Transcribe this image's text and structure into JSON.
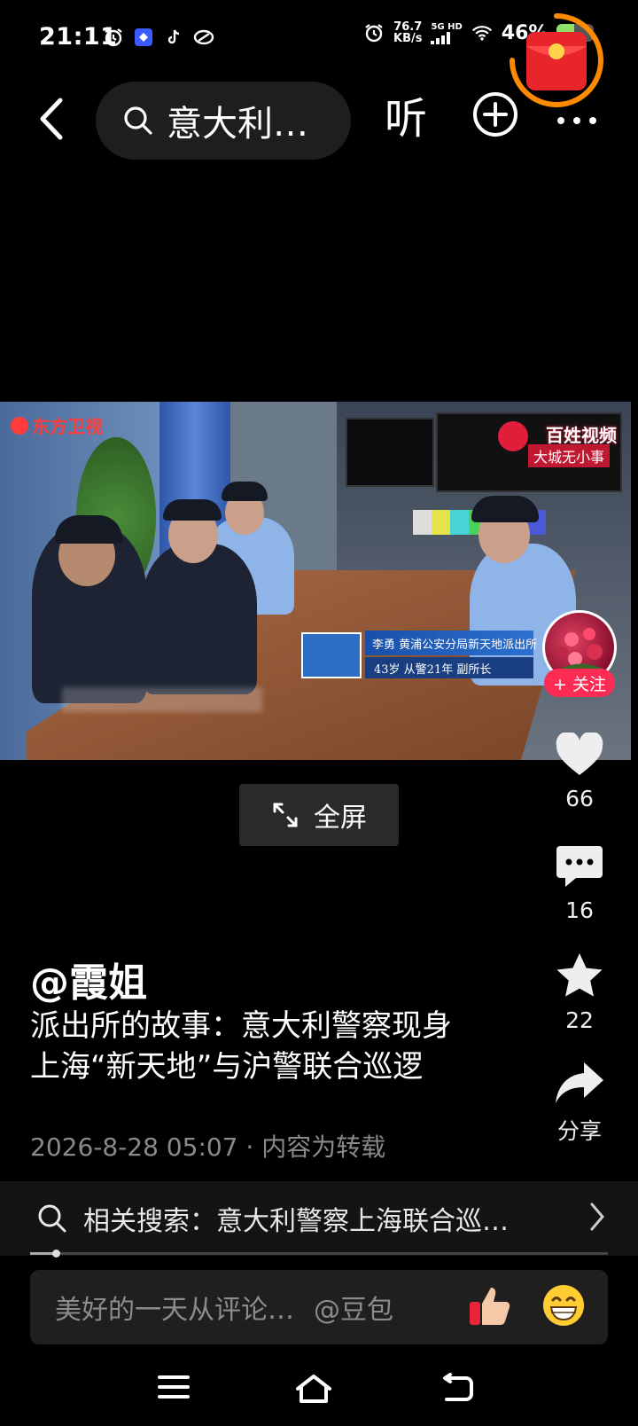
{
  "status_bar": {
    "time": "21:11",
    "speed_value": "76.7",
    "speed_unit": "KB/s",
    "network": "5G HD",
    "battery_text": "46%",
    "battery_level": 0.46
  },
  "top_nav": {
    "search_query": "意大利…",
    "listen_label": "听"
  },
  "video": {
    "channel_logo": "东方卫视",
    "program_title": "百姓视频",
    "program_subtitle": "大城无小事",
    "lower_third_name": "李勇 黄浦公安分局新天地派出所",
    "lower_third_sub": "43岁 从警21年 副所长"
  },
  "creator": {
    "follow_label": "+ 关注"
  },
  "fullscreen": {
    "label": "全屏"
  },
  "actions": {
    "likes": "66",
    "comments": "16",
    "favorites": "22",
    "share_label": "分享"
  },
  "caption": {
    "author": "@霞姐",
    "description": "派出所的故事：意大利警察现身上海“新天地”与沪警联合巡逻",
    "meta": "2026-8-28 05:07 · 内容为转载"
  },
  "related_search": {
    "text": "相关搜索：意大利警察上海联合巡…"
  },
  "playback": {
    "progress": 0.045
  },
  "comment_input": {
    "placeholder": "美好的一天从评论…",
    "mention": "@豆包"
  },
  "colors": {
    "accent": "#fe2c55",
    "background": "#000000",
    "red_packet_ring": "#ff8a00"
  }
}
